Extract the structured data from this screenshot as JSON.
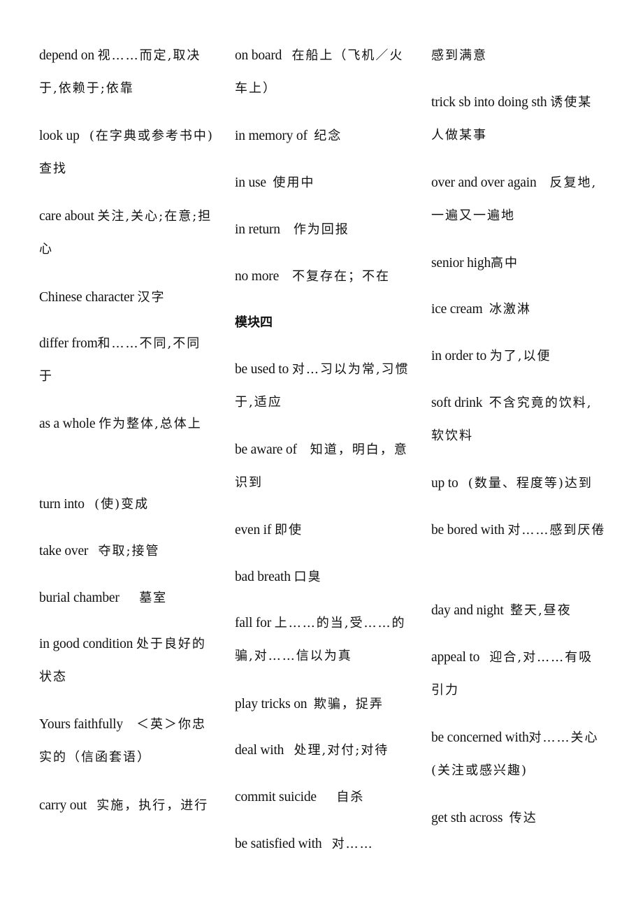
{
  "columns": [
    {
      "entries": [
        {
          "en": "depend on",
          "zh": "视……而定,取决于,依赖于;依靠"
        },
        {
          "en": "look up",
          "zh": "(在字典或参考书中)查找"
        },
        {
          "en": "care about",
          "zh": "关注,关心;在意;担心"
        },
        {
          "en": "Chinese character",
          "zh": "汉字"
        },
        {
          "en": "differ from",
          "zh": "和……不同,不同于"
        },
        {
          "en": "as a whole",
          "zh": "作为整体,总体上"
        },
        {
          "en": "turn into",
          "zh": "(使)变成"
        },
        {
          "en": "take over",
          "zh": "夺取;接管"
        },
        {
          "en": "burial chamber",
          "zh": "墓室"
        },
        {
          "en": "in good condition",
          "zh": "处于良好的状态"
        },
        {
          "en": "Yours faithfully",
          "zh": "＜英＞你忠实的（信函套语）"
        },
        {
          "en": "carry out",
          "zh": "实施，执行，进行"
        }
      ]
    },
    {
      "entries": [
        {
          "en": "on board",
          "zh": "在船上（飞机／火车上）"
        },
        {
          "en": "in memory of",
          "zh": "纪念"
        },
        {
          "en": "in use",
          "zh": "使用中"
        },
        {
          "en": "in return",
          "zh": "作为回报"
        },
        {
          "en": "no more",
          "zh": "不复存在；不在"
        }
      ],
      "heading": "模块四",
      "entries_after": [
        {
          "en": "be used to",
          "zh": "对…习以为常,习惯于,适应"
        },
        {
          "en": "be aware of",
          "zh": "知道，明白，意识到"
        },
        {
          "en": "even if",
          "zh": "即使"
        },
        {
          "en": "bad breath",
          "zh": "口臭"
        },
        {
          "en": "fall for",
          "zh": "上……的当,受……的骗,对……信以为真"
        },
        {
          "en": "play tricks on",
          "zh": "欺骗，捉弄"
        },
        {
          "en": "deal with",
          "zh": "处理,对付;对待"
        },
        {
          "en": "commit suicide",
          "zh": "自杀"
        },
        {
          "en": "be satisfied with",
          "zh": "对……"
        }
      ]
    },
    {
      "continuation": "感到满意",
      "entries": [
        {
          "en": "trick sb into doing sth",
          "zh": "诱使某人做某事"
        },
        {
          "en": "over and over again",
          "zh": "反复地,一遍又一遍地"
        },
        {
          "en": "senior high",
          "zh": "高中"
        },
        {
          "en": "ice cream",
          "zh": "冰激淋"
        },
        {
          "en": "in order to",
          "zh": "为了,以便"
        },
        {
          "en": "soft drink",
          "zh": "不含究竟的饮料,软饮料"
        },
        {
          "en": "up to",
          "zh": "(数量、程度等)达到"
        },
        {
          "en": "be bored with",
          "zh": "对……感到厌倦"
        },
        {
          "en": "day and night",
          "zh": "整天,昼夜"
        },
        {
          "en": "appeal to",
          "zh": "迎合,对……有吸引力"
        },
        {
          "en": "be concerned with",
          "zh": "对……关心(关注或感兴趣)"
        },
        {
          "en": "get sth across",
          "zh": "传达"
        }
      ]
    }
  ]
}
